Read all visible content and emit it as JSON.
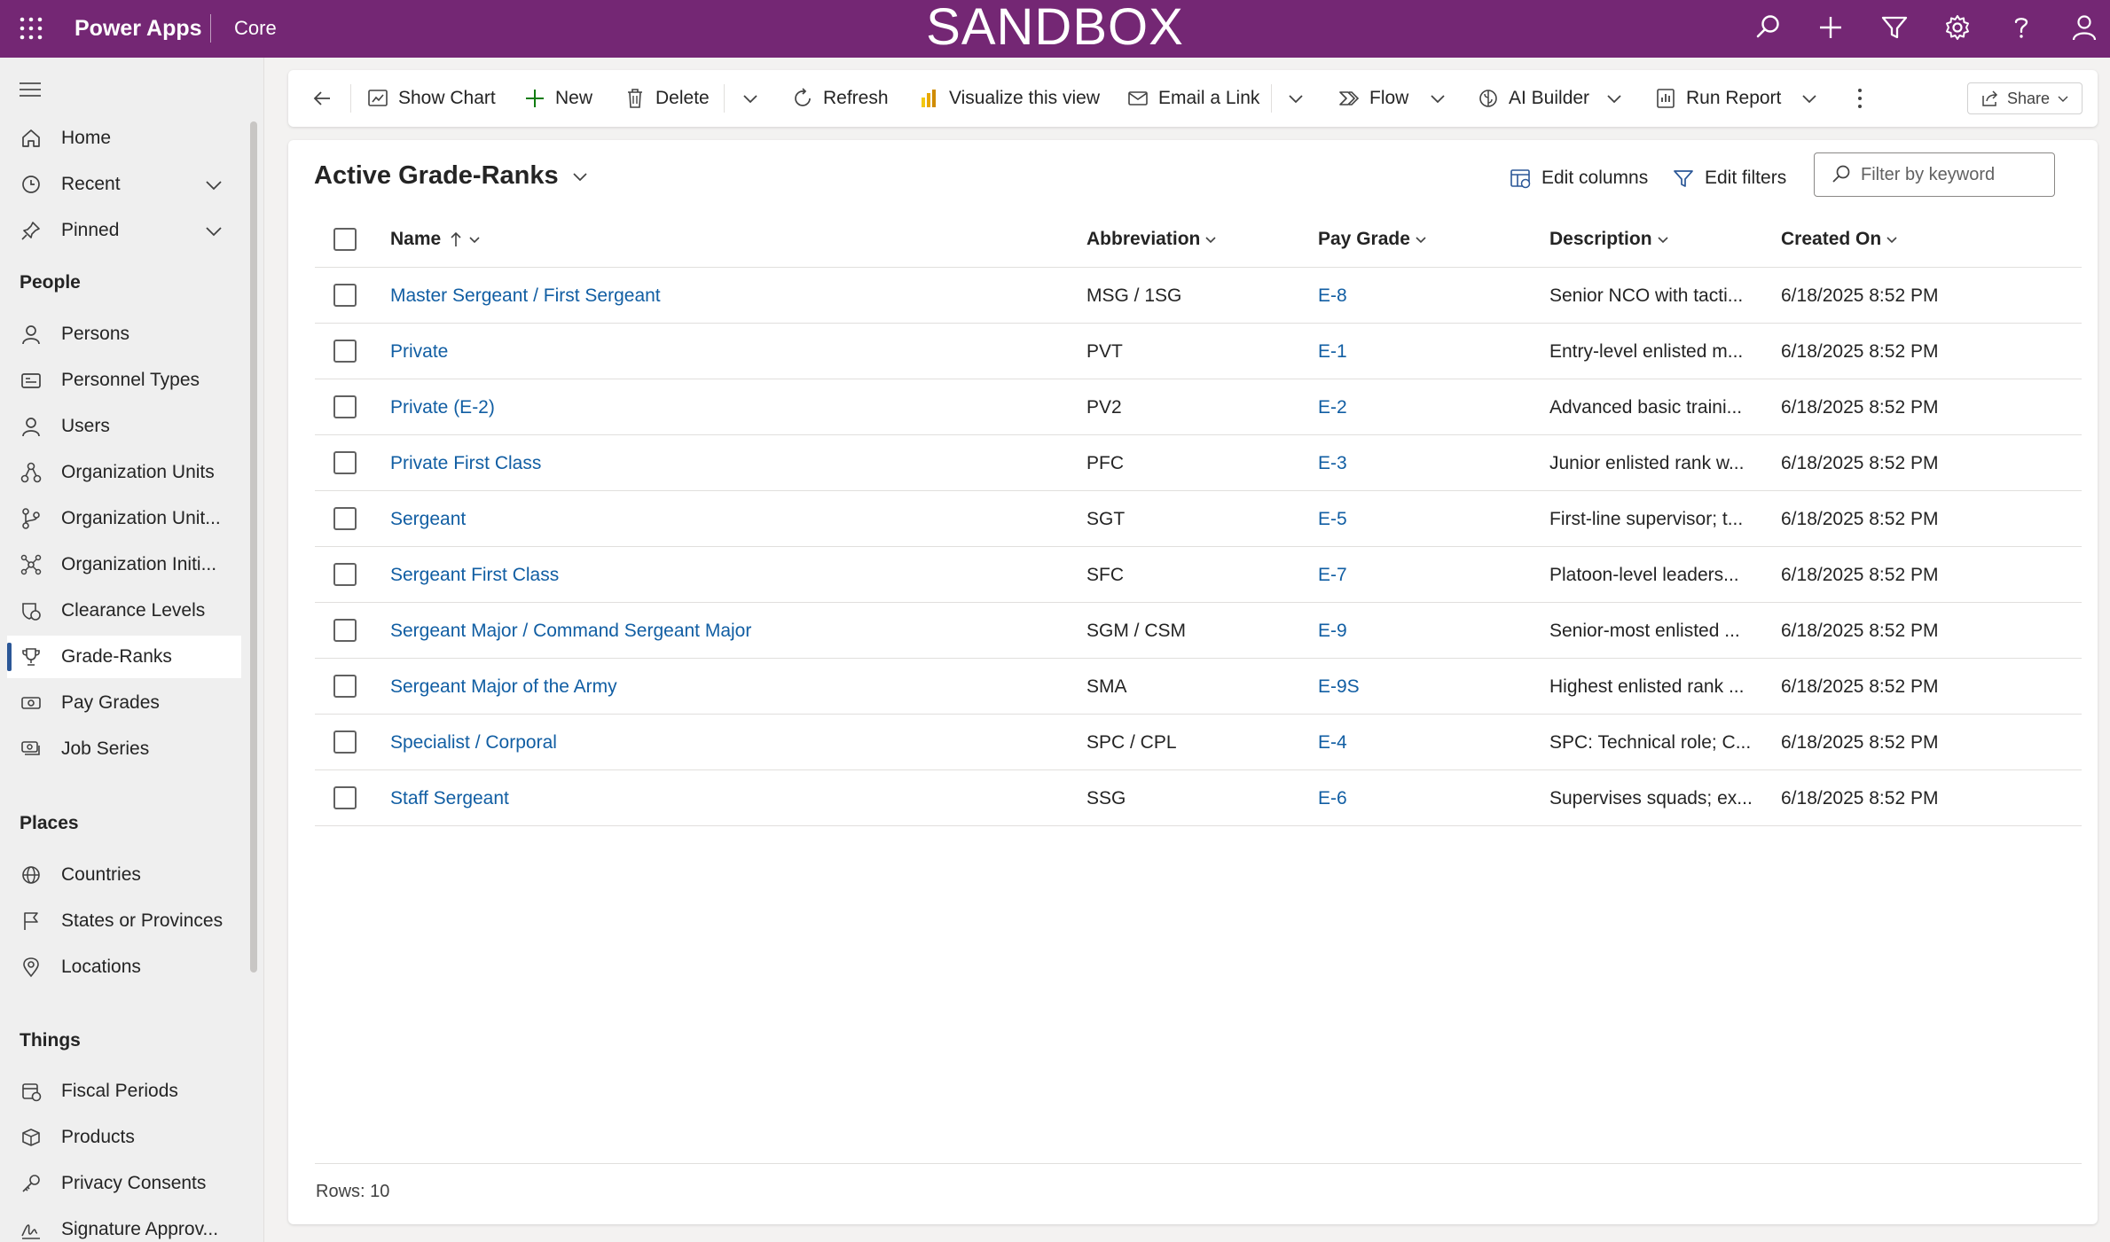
{
  "topbar": {
    "app_name": "Power Apps",
    "environment": "Core",
    "banner": "SANDBOX",
    "icons": [
      "search-icon",
      "add-icon",
      "filter-icon",
      "settings-icon",
      "help-icon",
      "user-icon"
    ],
    "color": "#742774"
  },
  "sidebar": {
    "top_items": [
      {
        "label": "Home",
        "icon": "home-icon"
      },
      {
        "label": "Recent",
        "icon": "clock-icon"
      },
      {
        "label": "Pinned",
        "icon": "pin-icon"
      }
    ],
    "groups": [
      {
        "title": "People",
        "items": [
          {
            "label": "Persons",
            "icon": "person-icon"
          },
          {
            "label": "Personnel Types",
            "icon": "card-icon"
          },
          {
            "label": "Users",
            "icon": "person-icon"
          },
          {
            "label": "Organization Units",
            "icon": "org-icon"
          },
          {
            "label": "Organization Unit...",
            "icon": "branch-icon"
          },
          {
            "label": "Organization Initi...",
            "icon": "hub-icon"
          },
          {
            "label": "Clearance Levels",
            "icon": "shield-icon"
          },
          {
            "label": "Grade-Ranks",
            "icon": "trophy-icon"
          },
          {
            "label": "Pay Grades",
            "icon": "money-icon"
          },
          {
            "label": "Job Series",
            "icon": "money-stack-icon"
          }
        ]
      },
      {
        "title": "Places",
        "items": [
          {
            "label": "Countries",
            "icon": "globe-icon"
          },
          {
            "label": "States or Provinces",
            "icon": "flag-icon"
          },
          {
            "label": "Locations",
            "icon": "location-icon"
          }
        ]
      },
      {
        "title": "Things",
        "items": [
          {
            "label": "Fiscal Periods",
            "icon": "calendar-icon"
          },
          {
            "label": "Products",
            "icon": "box-icon"
          },
          {
            "label": "Privacy Consents",
            "icon": "key-icon"
          },
          {
            "label": "Signature Approv...",
            "icon": "signature-icon"
          }
        ]
      }
    ],
    "selected": "Grade-Ranks"
  },
  "commandbar": {
    "show_chart": "Show Chart",
    "new": "New",
    "delete": "Delete",
    "refresh": "Refresh",
    "visualize": "Visualize this view",
    "email_link": "Email a Link",
    "flow": "Flow",
    "ai_builder": "AI Builder",
    "run_report": "Run Report",
    "share": "Share"
  },
  "view": {
    "title": "Active Grade-Ranks",
    "edit_columns": "Edit columns",
    "edit_filters": "Edit filters",
    "filter_placeholder": "Filter by keyword",
    "columns": [
      "Name",
      "Abbreviation",
      "Pay Grade",
      "Description",
      "Created On"
    ],
    "rows": [
      {
        "name": "Master Sergeant / First Sergeant",
        "abbreviation": "MSG / 1SG",
        "pay_grade": "E-8",
        "description": "Senior NCO with tacti...",
        "created_on": "6/18/2025 8:52 PM"
      },
      {
        "name": "Private",
        "abbreviation": "PVT",
        "pay_grade": "E-1",
        "description": "Entry-level enlisted m...",
        "created_on": "6/18/2025 8:52 PM"
      },
      {
        "name": "Private (E-2)",
        "abbreviation": "PV2",
        "pay_grade": "E-2",
        "description": "Advanced basic traini...",
        "created_on": "6/18/2025 8:52 PM"
      },
      {
        "name": "Private First Class",
        "abbreviation": "PFC",
        "pay_grade": "E-3",
        "description": "Junior enlisted rank w...",
        "created_on": "6/18/2025 8:52 PM"
      },
      {
        "name": "Sergeant",
        "abbreviation": "SGT",
        "pay_grade": "E-5",
        "description": "First-line supervisor; t...",
        "created_on": "6/18/2025 8:52 PM"
      },
      {
        "name": "Sergeant First Class",
        "abbreviation": "SFC",
        "pay_grade": "E-7",
        "description": "Platoon-level leaders...",
        "created_on": "6/18/2025 8:52 PM"
      },
      {
        "name": "Sergeant Major / Command Sergeant Major",
        "abbreviation": "SGM / CSM",
        "pay_grade": "E-9",
        "description": "Senior-most enlisted ...",
        "created_on": "6/18/2025 8:52 PM"
      },
      {
        "name": "Sergeant Major of the Army",
        "abbreviation": "SMA",
        "pay_grade": "E-9S",
        "description": "Highest enlisted rank ...",
        "created_on": "6/18/2025 8:52 PM"
      },
      {
        "name": "Specialist / Corporal",
        "abbreviation": "SPC / CPL",
        "pay_grade": "E-4",
        "description": "SPC: Technical role; C...",
        "created_on": "6/18/2025 8:52 PM"
      },
      {
        "name": "Staff Sergeant",
        "abbreviation": "SSG",
        "pay_grade": "E-6",
        "description": "Supervises squads; ex...",
        "created_on": "6/18/2025 8:52 PM"
      }
    ],
    "rows_label": "Rows: 10"
  }
}
